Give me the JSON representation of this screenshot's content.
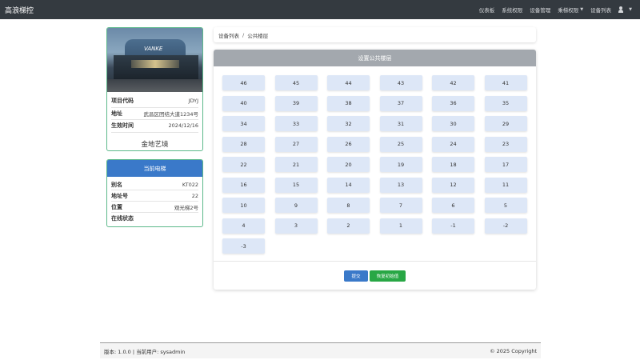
{
  "nav": {
    "brand": "高浪梯控",
    "links": [
      "仪表板",
      "系统权限",
      "设备管理",
      "乘梯权限",
      "设备列表"
    ]
  },
  "project": {
    "photo_text": "VANKE",
    "rows": [
      {
        "label": "项目代码",
        "value": "JDYJ"
      },
      {
        "label": "地址",
        "value": "武昌区团结大道1234号"
      },
      {
        "label": "生效时间",
        "value": "2024/12/16"
      }
    ],
    "name": "金地艺境"
  },
  "elevator": {
    "title": "当前电梯",
    "rows": [
      {
        "label": "别名",
        "value": "KT022"
      },
      {
        "label": "地址号",
        "value": "22"
      },
      {
        "label": "位置",
        "value": "观光梯2号"
      },
      {
        "label": "在线状态",
        "value": ""
      }
    ]
  },
  "breadcrumb": {
    "parent": "设备列表",
    "separator": "/",
    "current": "公共楼层"
  },
  "panel": {
    "title": "设置公共楼层",
    "floors": [
      "46",
      "45",
      "44",
      "43",
      "42",
      "41",
      "40",
      "39",
      "38",
      "37",
      "36",
      "35",
      "34",
      "33",
      "32",
      "31",
      "30",
      "29",
      "28",
      "27",
      "26",
      "25",
      "24",
      "23",
      "22",
      "21",
      "20",
      "19",
      "18",
      "17",
      "16",
      "15",
      "14",
      "13",
      "12",
      "11",
      "10",
      "9",
      "8",
      "7",
      "6",
      "5",
      "4",
      "3",
      "2",
      "1",
      "-1",
      "-2",
      "-3"
    ],
    "submit_label": "提交",
    "reset_label": "恢复初始值"
  },
  "footer": {
    "left": "版本: 1.0.0 | 当前用户: sysadmin",
    "right": "© 2025 Copyright"
  },
  "colors": {
    "nav_bg": "#343a40",
    "card_border": "#5cb88a",
    "primary": "#3a79c9",
    "success": "#28a745",
    "floor_btn": "#dde7f7",
    "panel_header": "#a3a8ae"
  },
  "icons": {
    "user_menu": "user-cog-icon",
    "dropdown": "caret-down-icon"
  }
}
